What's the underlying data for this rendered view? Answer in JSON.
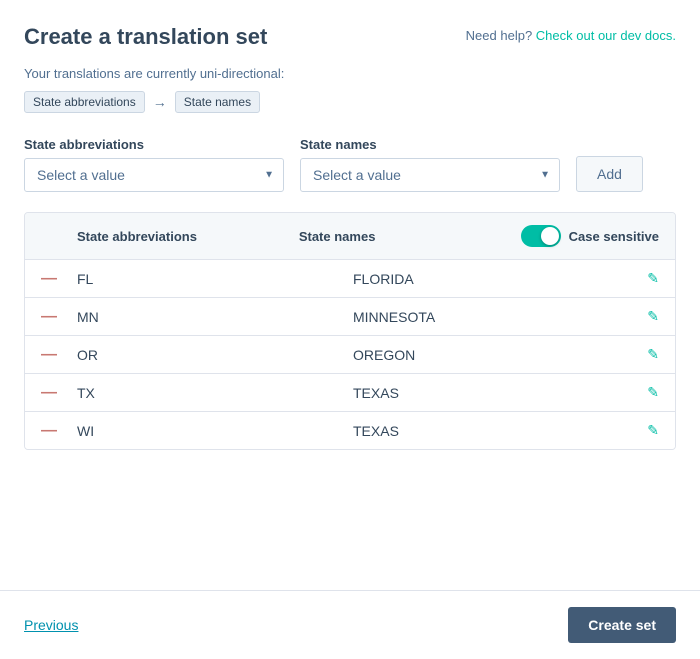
{
  "header": {
    "title": "Create a translation set",
    "help_prefix": "Need help?",
    "help_link": "Check out our dev docs."
  },
  "direction": {
    "info": "Your translations are currently uni-directional:",
    "from_badge": "State abbreviations",
    "arrow": "→",
    "to_badge": "State names"
  },
  "from_column": {
    "label": "State abbreviations",
    "placeholder": "Select a value"
  },
  "to_column": {
    "label": "State names",
    "placeholder": "Select a value"
  },
  "add_button": "Add",
  "table": {
    "col_from": "State abbreviations",
    "col_to": "State names",
    "case_label": "Case sensitive",
    "rows": [
      {
        "abbrev": "FL",
        "name": "FLORIDA"
      },
      {
        "abbrev": "MN",
        "name": "MINNESOTA"
      },
      {
        "abbrev": "OR",
        "name": "OREGON"
      },
      {
        "abbrev": "TX",
        "name": "TEXAS"
      },
      {
        "abbrev": "WI",
        "name": "TEXAS"
      }
    ]
  },
  "footer": {
    "previous_label": "Previous",
    "create_label": "Create set"
  }
}
